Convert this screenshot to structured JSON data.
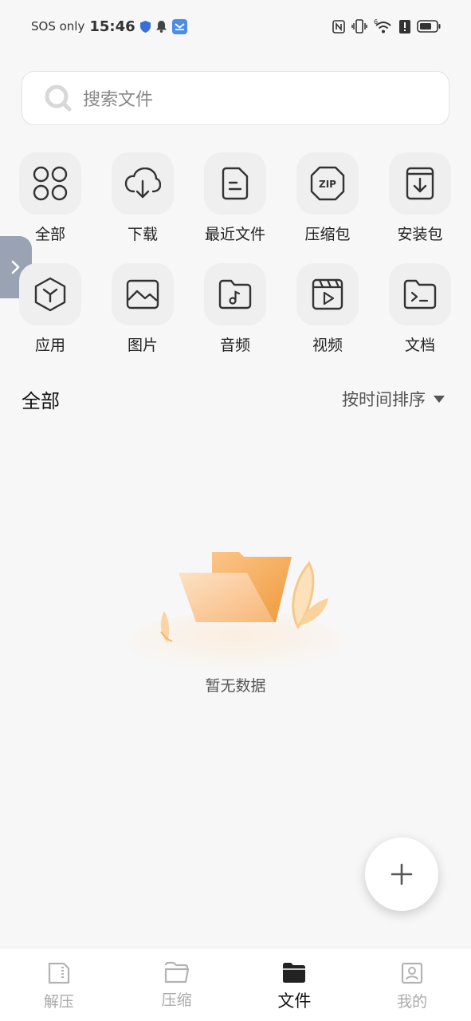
{
  "status_bar": {
    "carrier": "SOS only",
    "time": "15:46",
    "wifi_badge": "6",
    "icons": [
      "shield-icon",
      "bell-icon",
      "app-badge-icon",
      "nfc-icon",
      "vibrate-icon",
      "wifi-icon",
      "alert-icon",
      "battery-icon"
    ]
  },
  "search": {
    "placeholder": "搜索文件"
  },
  "categories": [
    {
      "label": "全部",
      "icon": "grid-icon"
    },
    {
      "label": "下载",
      "icon": "cloud-download-icon"
    },
    {
      "label": "最近文件",
      "icon": "recent-file-icon"
    },
    {
      "label": "压缩包",
      "icon": "zip-icon"
    },
    {
      "label": "安装包",
      "icon": "install-package-icon"
    },
    {
      "label": "应用",
      "icon": "cube-icon"
    },
    {
      "label": "图片",
      "icon": "image-icon"
    },
    {
      "label": "音频",
      "icon": "audio-folder-icon"
    },
    {
      "label": "视频",
      "icon": "video-icon"
    },
    {
      "label": "文档",
      "icon": "terminal-doc-icon"
    }
  ],
  "section": {
    "title": "全部",
    "sort_label": "按时间排序"
  },
  "empty": {
    "text": "暂无数据"
  },
  "fab": {
    "icon": "plus-icon"
  },
  "bottom_nav": [
    {
      "label": "解压",
      "icon": "extract-icon",
      "active": false
    },
    {
      "label": "压缩",
      "icon": "compress-folder-icon",
      "active": false
    },
    {
      "label": "文件",
      "icon": "folder-icon",
      "active": true
    },
    {
      "label": "我的",
      "icon": "profile-icon",
      "active": false
    }
  ],
  "colors": {
    "accent_orange": "#f5a64f",
    "side_tab": "#9aa3b4",
    "background": "#f7f7f7"
  }
}
